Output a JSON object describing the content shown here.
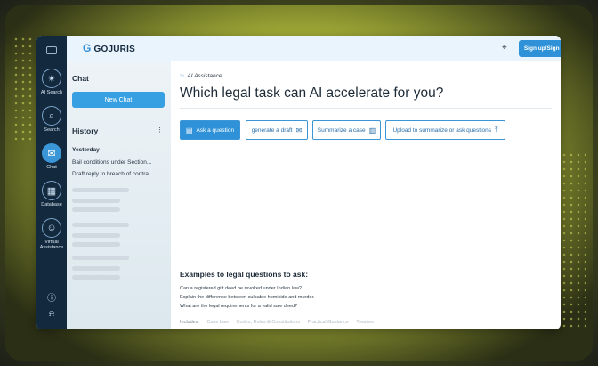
{
  "header": {
    "logo_mark": "G",
    "logo_text": "GOJURIS",
    "signin_label": "Sign up/Sign In"
  },
  "rail": {
    "items": [
      {
        "label": "AI Search",
        "icon": "ai-search-icon"
      },
      {
        "label": "Search",
        "icon": "search-icon"
      },
      {
        "label": "Chat",
        "icon": "chat-icon"
      },
      {
        "label": "Database",
        "icon": "database-icon"
      },
      {
        "label": "Virtual Assistance",
        "icon": "virtual-assistance-icon"
      }
    ]
  },
  "sidebar": {
    "title": "Chat",
    "new_chat_label": "New Chat",
    "history_title": "History",
    "history_group": "Yesterday",
    "history_items": [
      "Bail conditions under Section...",
      "Draft reply to breach of contra..."
    ]
  },
  "main": {
    "assistance_label": "AI Assistance",
    "headline": "Which legal task can AI accelerate for you?",
    "chips": [
      {
        "label": "Ask a question",
        "icon": "chat-icon"
      },
      {
        "label": "generate a draft",
        "icon": "mail-icon"
      },
      {
        "label": "Summarize a case",
        "icon": "document-icon"
      },
      {
        "label": "Upload to summarize or ask questions",
        "icon": "upload-icon"
      }
    ],
    "examples_title": "Examples to legal questions to ask:",
    "examples": [
      "Can a registered gift deed be revoked under Indian law?",
      "Explain the difference between culpable homicide and murder.",
      "What are the legal requirements for a valid sale deed?"
    ],
    "includes_label": "Includes:",
    "includes": [
      "Case Law",
      "Codes, Rules & Constitutions",
      "Practical Guidance",
      "Treaties"
    ],
    "ask_placeholder": "Ask a question"
  },
  "colors": {
    "accent": "#2f92d8",
    "rail": "#12293e"
  }
}
